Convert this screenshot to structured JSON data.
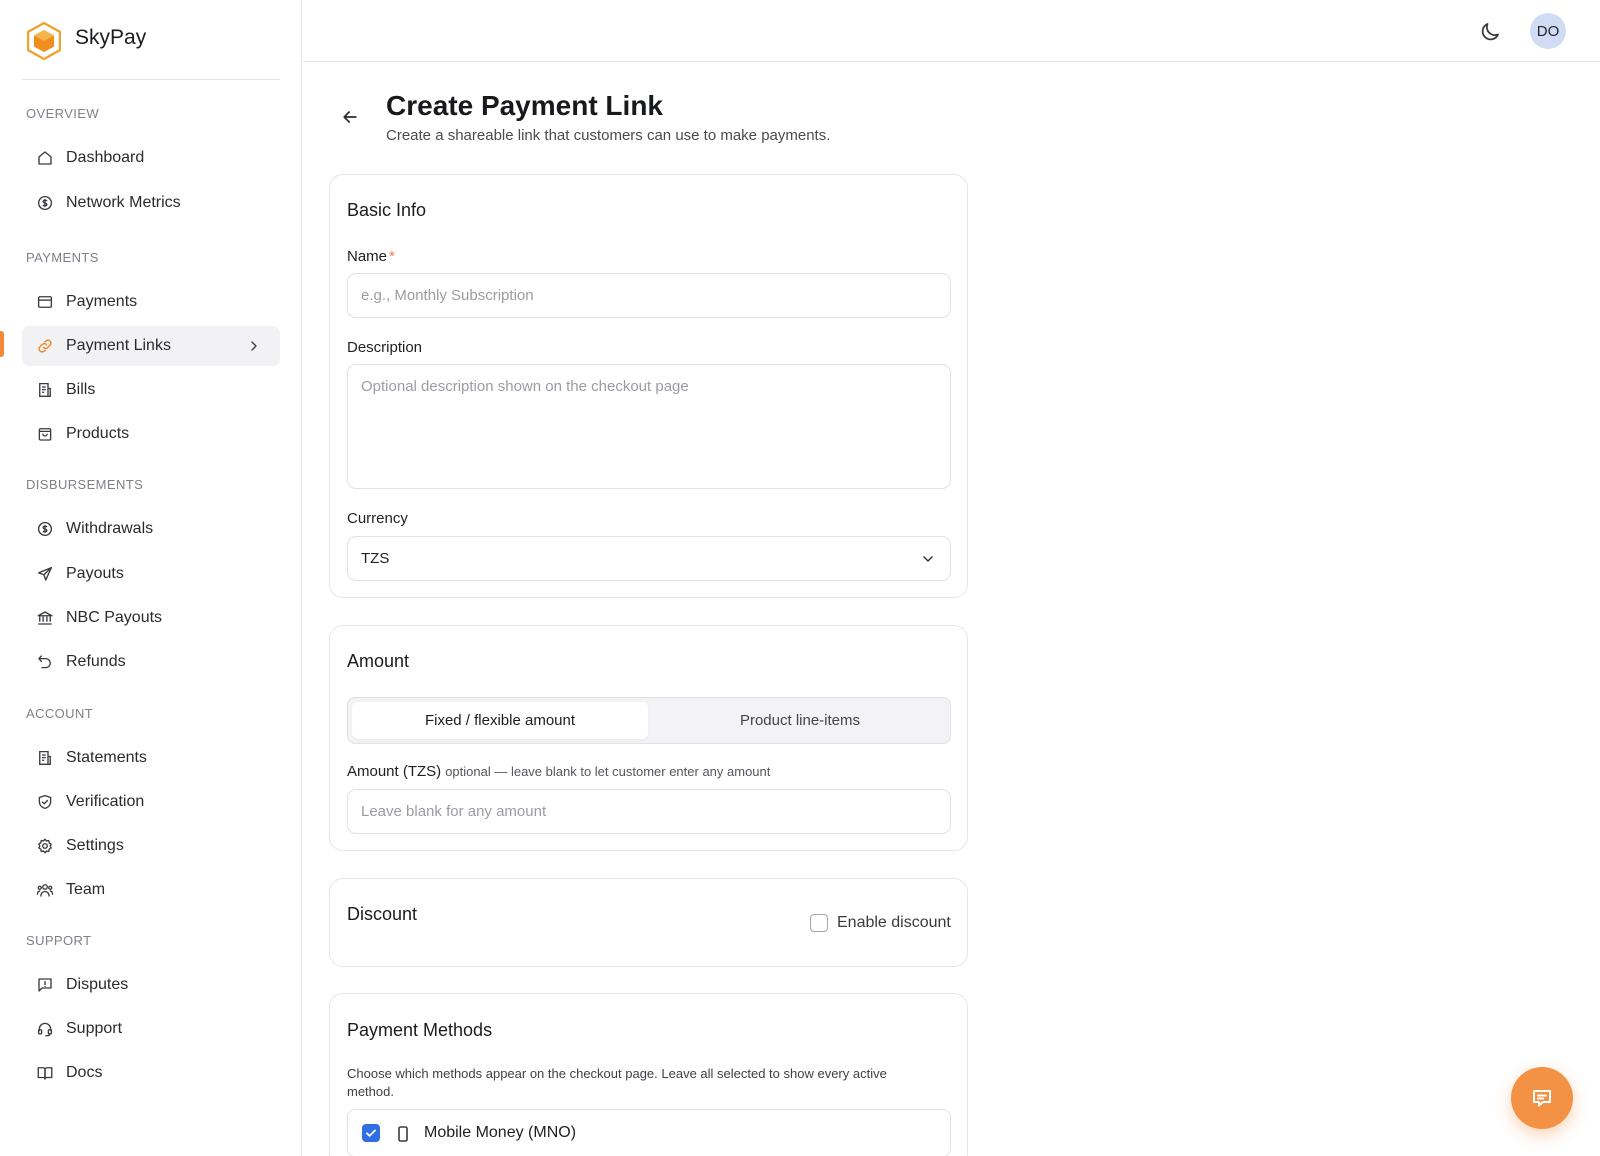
{
  "app": {
    "name": "SkyPay",
    "accent_color": "#f08a32"
  },
  "header": {
    "avatar_initials": "DO",
    "theme_icon": "moon-icon"
  },
  "sidebar": {
    "sections": {
      "overview": "OVERVIEW",
      "payments": "PAYMENTS",
      "disbursements": "DISBURSEMENTS",
      "account": "ACCOUNT",
      "support": "SUPPORT"
    },
    "items": {
      "dashboard": {
        "label": "Dashboard",
        "icon": "home-icon"
      },
      "network_metrics": {
        "label": "Network Metrics",
        "icon": "dollar-circle-icon"
      },
      "payments": {
        "label": "Payments",
        "icon": "card-icon"
      },
      "payment_links": {
        "label": "Payment Links",
        "icon": "link-icon",
        "active": true
      },
      "bills": {
        "label": "Bills",
        "icon": "receipt-icon"
      },
      "products": {
        "label": "Products",
        "icon": "bag-icon"
      },
      "withdrawals": {
        "label": "Withdrawals",
        "icon": "dollar-circle-icon"
      },
      "payouts": {
        "label": "Payouts",
        "icon": "send-icon"
      },
      "nbc_payouts": {
        "label": "NBC Payouts",
        "icon": "bank-icon"
      },
      "refunds": {
        "label": "Refunds",
        "icon": "undo-icon"
      },
      "statements": {
        "label": "Statements",
        "icon": "receipt-icon"
      },
      "verification": {
        "label": "Verification",
        "icon": "shield-icon"
      },
      "settings": {
        "label": "Settings",
        "icon": "gear-icon"
      },
      "team": {
        "label": "Team",
        "icon": "users-icon"
      },
      "disputes": {
        "label": "Disputes",
        "icon": "flag-message-icon"
      },
      "support": {
        "label": "Support",
        "icon": "headset-icon"
      },
      "docs": {
        "label": "Docs",
        "icon": "book-icon"
      }
    }
  },
  "page": {
    "title": "Create Payment Link",
    "subtitle": "Create a shareable link that customers can use to make payments."
  },
  "basic_info": {
    "title": "Basic Info",
    "name_label": "Name",
    "name_required_mark": "*",
    "name_placeholder": "e.g., Monthly Subscription",
    "description_label": "Description",
    "description_placeholder": "Optional description shown on the checkout page",
    "currency_label": "Currency",
    "currency_value": "TZS"
  },
  "amount": {
    "title": "Amount",
    "tabs": [
      "Fixed / flexible amount",
      "Product line-items"
    ],
    "selected_tab": "Fixed / flexible amount",
    "amount_label": "Amount (TZS)",
    "amount_hint": "optional — leave blank to let customer enter any amount",
    "amount_placeholder": "Leave blank for any amount"
  },
  "discount": {
    "title": "Discount",
    "enable_label": "Enable discount",
    "enabled": false
  },
  "payment_methods": {
    "title": "Payment Methods",
    "description": "Choose which methods appear on the checkout page. Leave all selected to show every active method.",
    "methods": [
      {
        "label": "Mobile Money (MNO)",
        "checked": true,
        "icon": "phone-icon"
      }
    ]
  },
  "chat": {
    "icon": "chat-icon"
  }
}
